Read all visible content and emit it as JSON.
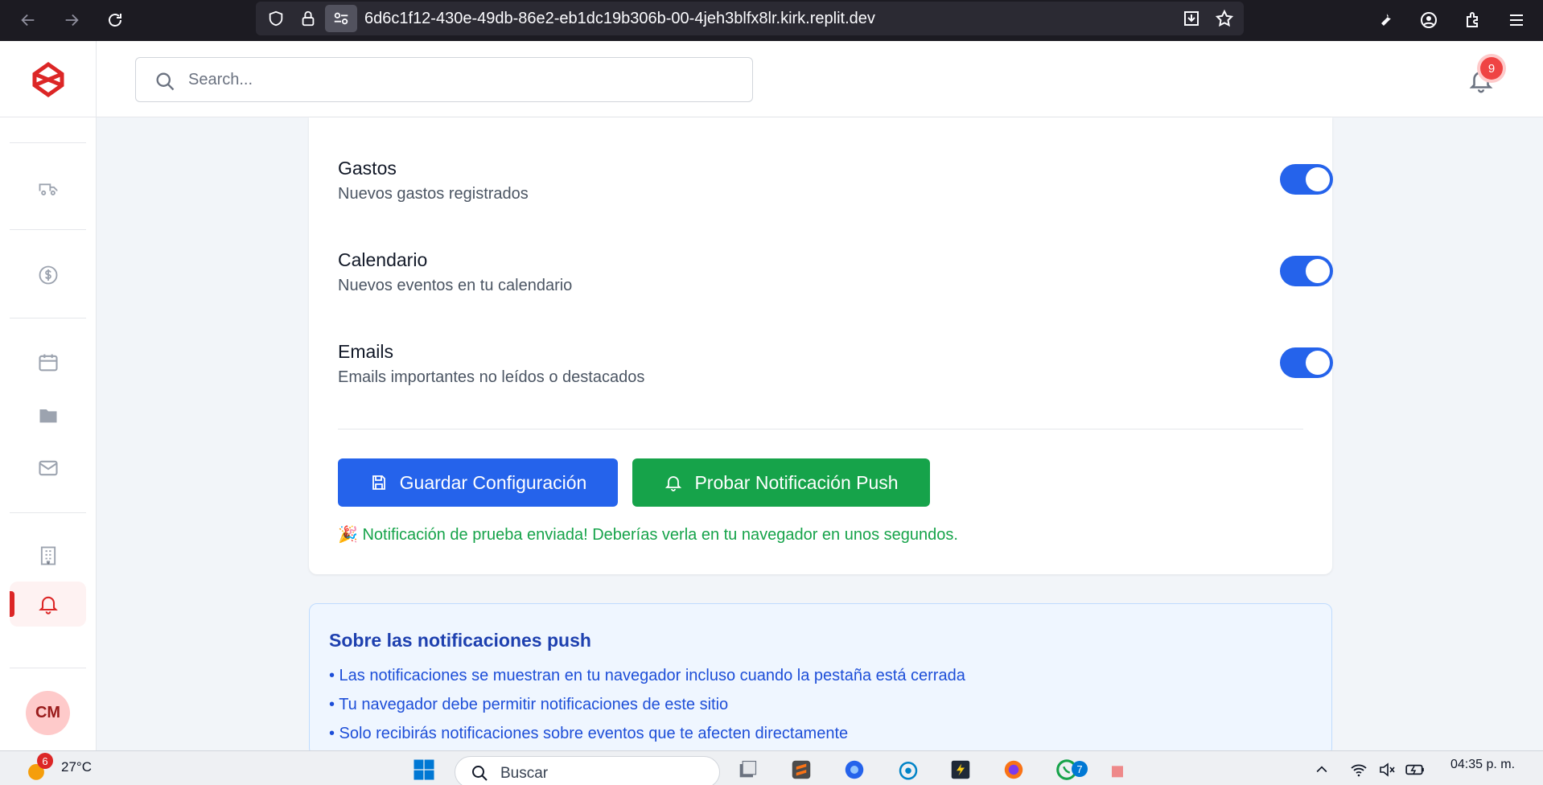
{
  "browser": {
    "url": "6d6c1f12-430e-49db-86e2-eb1dc19b306b-00-4jeh3blfx8lr.kirk.replit.dev"
  },
  "header": {
    "search_placeholder": "Search...",
    "notification_count": "9"
  },
  "sidebar": {
    "avatar_initials": "CM",
    "items": [
      "truck-icon",
      "dollar-icon",
      "calendar-icon",
      "folder-icon",
      "mail-icon",
      "building-icon",
      "bell-icon"
    ],
    "active_item": "bell-icon"
  },
  "settings": [
    {
      "title": "Gastos",
      "description": "Nuevos gastos registrados",
      "enabled": true
    },
    {
      "title": "Calendario",
      "description": "Nuevos eventos en tu calendario",
      "enabled": true
    },
    {
      "title": "Emails",
      "description": "Emails importantes no leídos o destacados",
      "enabled": true
    }
  ],
  "actions": {
    "save_label": "Guardar Configuración",
    "push_label": "Probar Notificación Push"
  },
  "success_message": "🎉 Notificación de prueba enviada! Deberías verla en tu navegador en unos segundos.",
  "info": {
    "title": "Sobre las notificaciones push",
    "lines": [
      "• Las notificaciones se muestran en tu navegador incluso cuando la pestaña está cerrada",
      "• Tu navegador debe permitir notificaciones de este sitio",
      "• Solo recibirás notificaciones sobre eventos que te afecten directamente"
    ]
  },
  "taskbar": {
    "weather_badge": "6",
    "temperature": "27°C",
    "search_label": "Buscar",
    "whatsapp_badge": "7",
    "time": "04:35 p. m."
  },
  "colors": {
    "primary": "#2563eb",
    "success": "#16a34a",
    "brand": "#dc2626"
  }
}
